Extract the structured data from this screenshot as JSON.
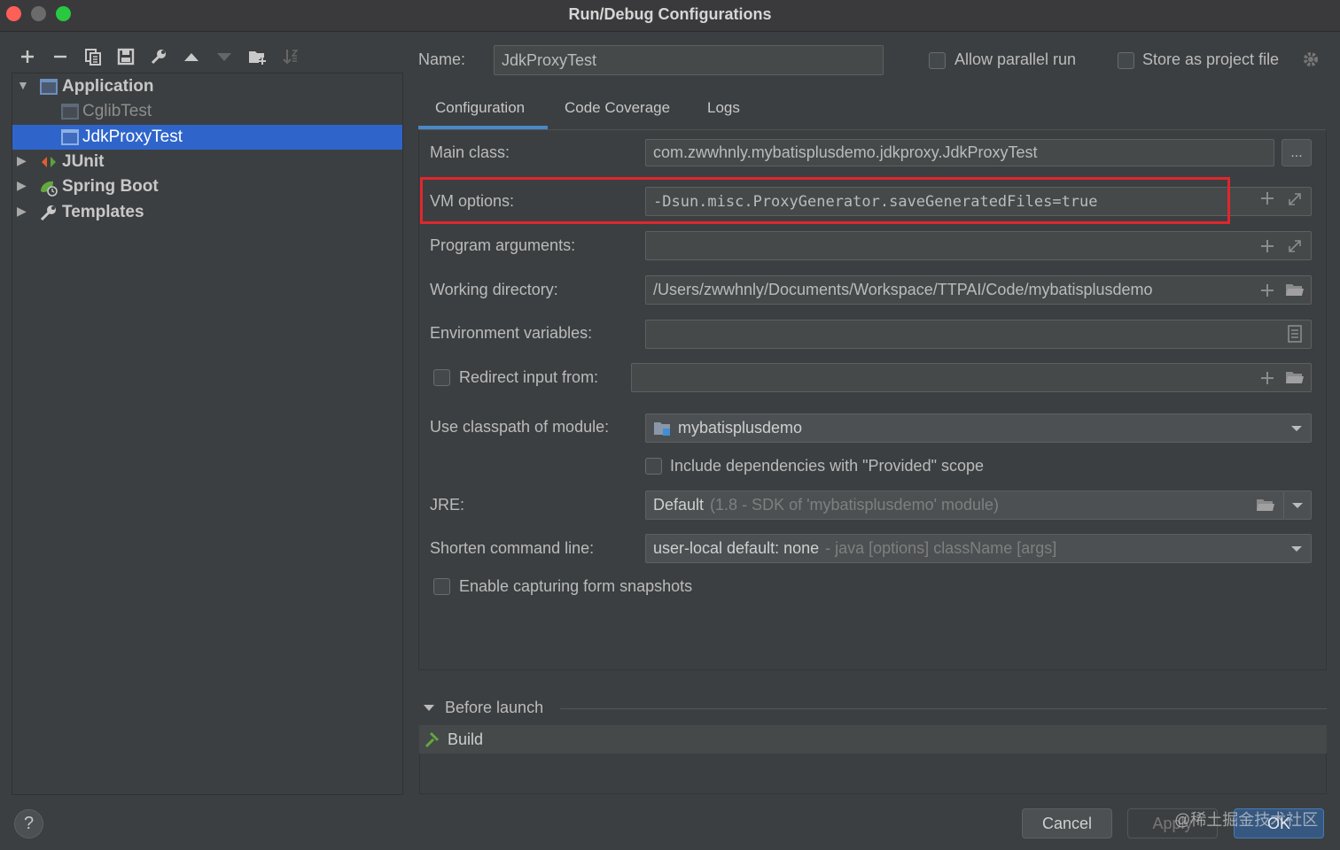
{
  "window": {
    "title": "Run/Debug Configurations"
  },
  "toolbar": {
    "icons": [
      "add-icon",
      "remove-icon",
      "copy-icon",
      "save-icon",
      "wrench-icon",
      "move-up-icon",
      "move-down-icon",
      "new-folder-icon",
      "sort-icon"
    ]
  },
  "tree": {
    "items": [
      {
        "label": "Application",
        "expanded": true
      },
      {
        "label": "CglibTest"
      },
      {
        "label": "JdkProxyTest",
        "selected": true
      },
      {
        "label": "JUnit"
      },
      {
        "label": "Spring Boot"
      },
      {
        "label": "Templates"
      }
    ]
  },
  "header": {
    "name_label": "Name:",
    "name_value": "JdkProxyTest",
    "allow_parallel_label": "Allow parallel run",
    "store_project_label": "Store as project file"
  },
  "tabs": [
    {
      "label": "Configuration",
      "active": true
    },
    {
      "label": "Code Coverage"
    },
    {
      "label": "Logs"
    }
  ],
  "config": {
    "main_class_label": "Main class:",
    "main_class_value": "com.zwwhnly.mybatisplusdemo.jdkproxy.JdkProxyTest",
    "main_class_btn": "...",
    "vm_options_label": "VM options:",
    "vm_options_value": "-Dsun.misc.ProxyGenerator.saveGeneratedFiles=true",
    "program_args_label": "Program arguments:",
    "program_args_value": "",
    "working_dir_label": "Working directory:",
    "working_dir_value": "/Users/zwwhnly/Documents/Workspace/TTPAI/Code/mybatisplusdemo",
    "env_vars_label": "Environment variables:",
    "env_vars_value": "",
    "redirect_label": "Redirect input from:",
    "redirect_value": "",
    "classpath_label": "Use classpath of module:",
    "classpath_value": "mybatisplusdemo",
    "include_deps_label": "Include dependencies with \"Provided\" scope",
    "jre_label": "JRE:",
    "jre_value": "Default",
    "jre_hint": "(1.8 - SDK of 'mybatisplusdemo' module)",
    "shorten_label": "Shorten command line:",
    "shorten_value": "user-local default: none",
    "shorten_hint": "- java [options] className [args]",
    "snapshots_label": "Enable capturing form snapshots"
  },
  "before_launch": {
    "label": "Before launch",
    "tasks": [
      {
        "label": "Build"
      }
    ]
  },
  "footer": {
    "help": "?",
    "cancel": "Cancel",
    "apply": "Apply",
    "ok": "OK",
    "watermark": "@稀土掘金技术社区"
  },
  "colors": {
    "accent": "#2f65ca",
    "highlight_border": "#e0262d",
    "ok_button": "#365880"
  }
}
